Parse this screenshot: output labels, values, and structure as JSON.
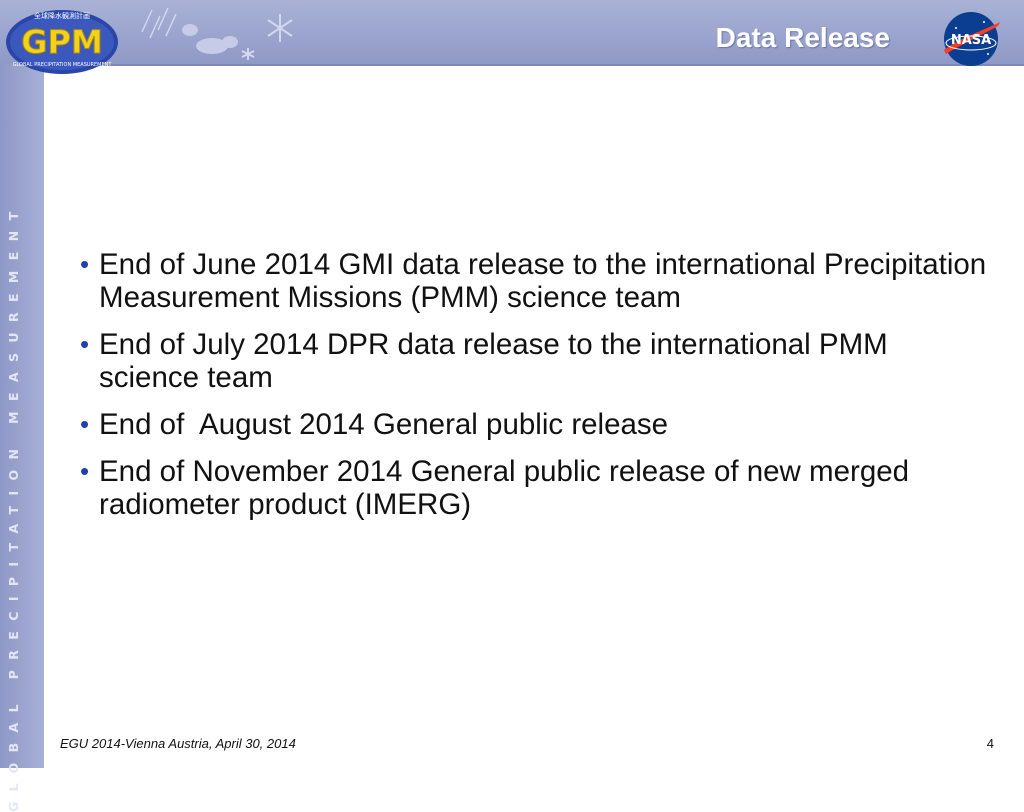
{
  "header": {
    "title": "Data Release",
    "gpm_logo_text": "GPM",
    "gpm_logo_subtext": "GLOBAL PRECIPITATION MEASUREMENT",
    "gpm_logo_top_text": "全球降水観測計画",
    "nasa_logo_text": "NASA"
  },
  "sidebar": {
    "vertical_text": "GLOBAL PRECIPITATION MEASUREMENT"
  },
  "bullets": [
    "End of June 2014 GMI data release to the international Precipitation Measurement Missions (PMM) science team",
    "End of July 2014 DPR data release to the international PMM science team",
    "End of  August 2014 General public release",
    "End of November 2014 General public release of new merged radiometer product (IMERG)"
  ],
  "bullet_marker": "•",
  "footer": {
    "text": "EGU 2014-Vienna Austria, April 30, 2014",
    "page_number": "4"
  },
  "colors": {
    "header_band": "#9aa3cd",
    "bullet_marker": "#1f3fae",
    "gpm_logo_yellow": "#f2d21a",
    "gpm_logo_blue": "#2b46a8",
    "nasa_blue": "#0b3d91",
    "nasa_red": "#fc3d21"
  }
}
